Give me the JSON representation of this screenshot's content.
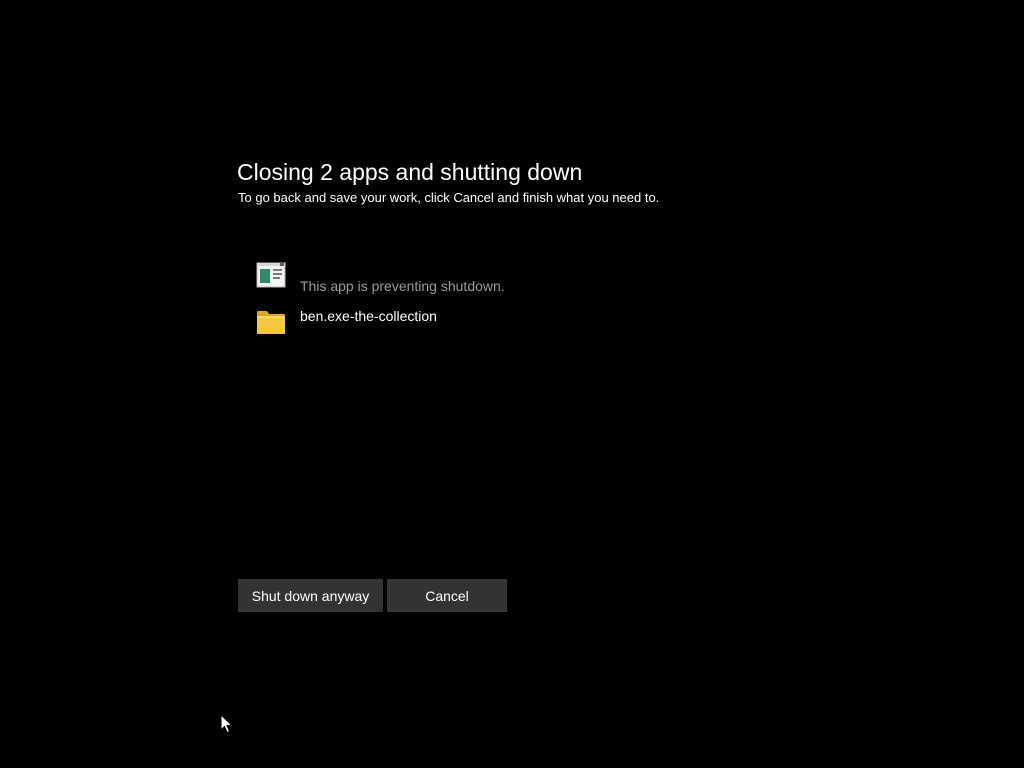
{
  "dialog": {
    "title": "Closing 2 apps and shutting down",
    "subtitle": "To go back and save your work, click Cancel and finish what you need to."
  },
  "apps": [
    {
      "icon": "app-window-icon",
      "text": "This app is preventing shutdown."
    },
    {
      "icon": "folder-icon",
      "text": "ben.exe-the-collection"
    }
  ],
  "buttons": {
    "shutdown_label": "Shut down anyway",
    "cancel_label": "Cancel"
  },
  "colors": {
    "background": "#000000",
    "button": "#333333",
    "text": "#ffffff",
    "muted_text": "#9a9a9a",
    "folder": "#f5c842"
  }
}
